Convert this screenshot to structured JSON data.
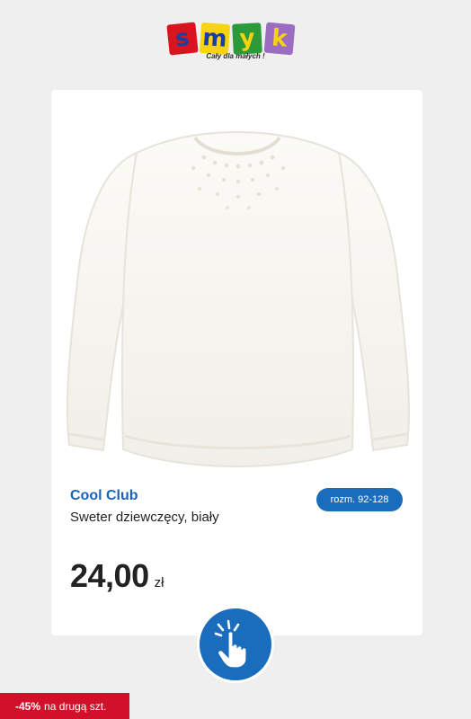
{
  "logo": {
    "letters": [
      "s",
      "m",
      "y",
      "k"
    ],
    "tagline": "Cały dla małych !",
    "colors": {
      "s_bg": "#d9141f",
      "m_bg": "#f7d312",
      "y_bg": "#2d9a3a",
      "k_bg": "#9a6cc2",
      "letter": "#1b3fa0"
    }
  },
  "product": {
    "brand": "Cool Club",
    "title": "Sweter dziewczęcy, biały",
    "size_badge": "rozm. 92-128",
    "price": "24,00",
    "currency": "zł",
    "image": "white-fluffy-sweater"
  },
  "cta": {
    "icon": "tap-hand-icon"
  },
  "promo": {
    "percent": "-45%",
    "text": "na drugą szt."
  },
  "colors": {
    "background": "#efefef",
    "accent_blue": "#1a6dbd",
    "brand_blue": "#1a63b8",
    "promo_red": "#d2102a"
  }
}
